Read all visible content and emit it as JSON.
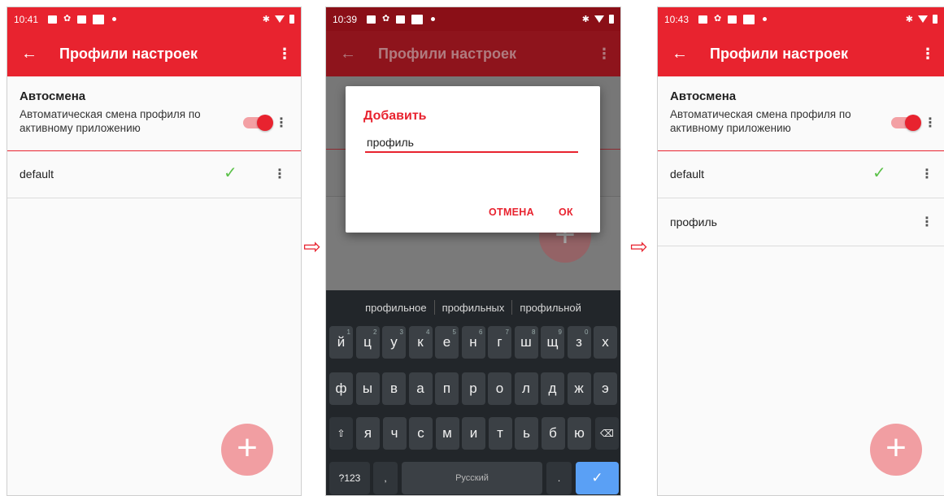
{
  "colors": {
    "accent": "#e8232f",
    "check": "#5cc14a",
    "fab": "#f19ea2",
    "keyboard": "#22262a",
    "enter_key": "#5aa0f5"
  },
  "screen1": {
    "status_time": "10:41",
    "app_title": "Профили настроек",
    "autochange_title": "Автосмена",
    "autochange_desc": "Автоматическая смена профиля по активному приложению",
    "profiles": [
      {
        "label": "default",
        "active": true
      }
    ]
  },
  "screen2": {
    "status_time": "10:39",
    "app_title": "Профили настроек",
    "dialog_title": "Добавить",
    "dialog_input_value": "профиль",
    "cancel_label": "ОТМЕНА",
    "ok_label": "ОК",
    "suggestions": [
      "профильное",
      "профильных",
      "профильной"
    ],
    "keyboard": {
      "row1": [
        "й",
        "ц",
        "у",
        "к",
        "е",
        "н",
        "г",
        "ш",
        "щ",
        "з",
        "х"
      ],
      "row1_hints": [
        "1",
        "2",
        "3",
        "4",
        "5",
        "6",
        "7",
        "8",
        "9",
        "0",
        ""
      ],
      "row2": [
        "ф",
        "ы",
        "в",
        "а",
        "п",
        "р",
        "о",
        "л",
        "д",
        "ж",
        "э"
      ],
      "row3": [
        "я",
        "ч",
        "с",
        "м",
        "и",
        "т",
        "ь",
        "б",
        "ю"
      ],
      "shift_icon": "shift-icon",
      "backspace_icon": "backspace-icon",
      "symbols_label": "?123",
      "comma_label": ",",
      "space_label": "Русский",
      "period_label": ".",
      "enter_icon": "checkmark-icon"
    }
  },
  "screen3": {
    "status_time": "10:43",
    "app_title": "Профили настроек",
    "autochange_title": "Автосмена",
    "autochange_desc": "Автоматическая смена профиля по активному приложению",
    "profiles": [
      {
        "label": "default",
        "active": true
      },
      {
        "label": "профиль",
        "active": false
      }
    ]
  },
  "icons": {
    "back": "←",
    "more": "⋮",
    "check": "✓",
    "fab": "+",
    "arrow": "⇨"
  }
}
